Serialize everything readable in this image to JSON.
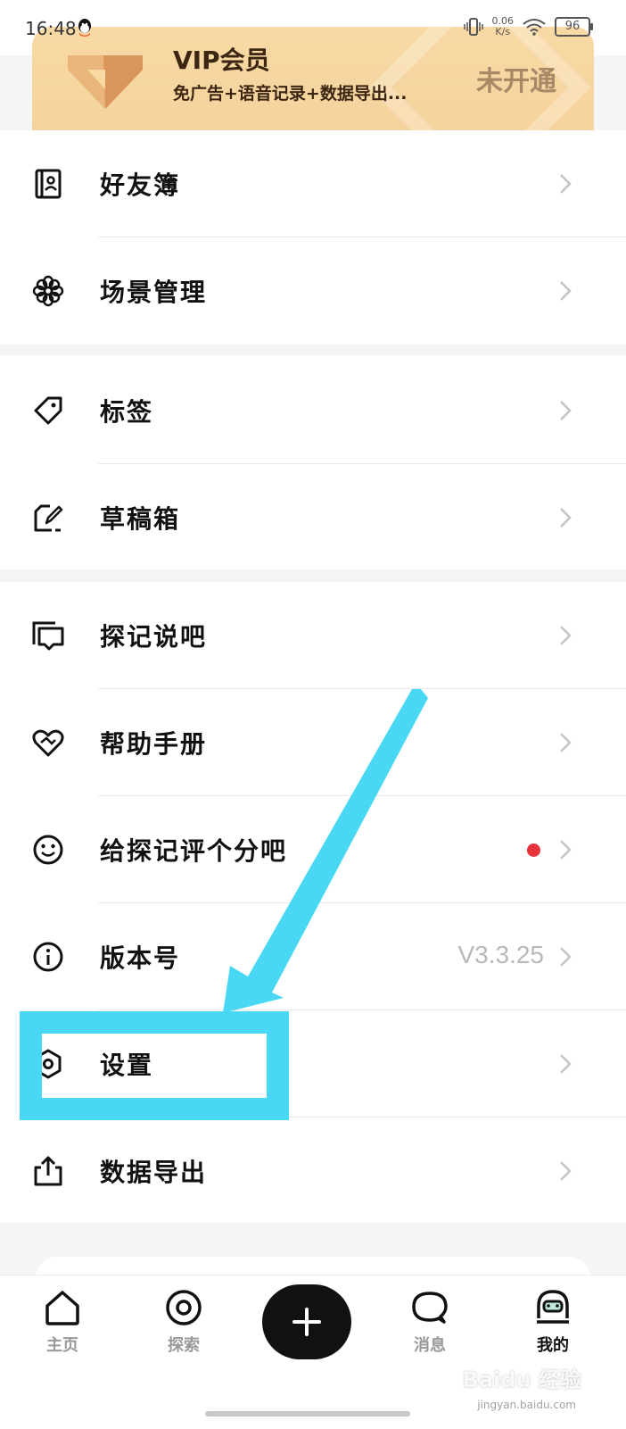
{
  "status_bar": {
    "time": "16:48",
    "net_speed_value": "0.06",
    "net_speed_unit": "K/s",
    "battery": "96"
  },
  "vip": {
    "title": "VIP会员",
    "subtitle": "免广告+语音记录+数据导出...",
    "status": "未开通"
  },
  "menu_groups": [
    [
      {
        "label": "好友簿",
        "icon": "contacts-book-icon"
      },
      {
        "label": "场景管理",
        "icon": "flower-icon"
      }
    ],
    [
      {
        "label": "标签",
        "icon": "tag-icon"
      },
      {
        "label": "草稿箱",
        "icon": "draft-edit-icon"
      }
    ],
    [
      {
        "label": "探记说吧",
        "icon": "chat-bubble-icon"
      },
      {
        "label": "帮助手册",
        "icon": "heart-handshake-icon"
      },
      {
        "label": "给探记评个分吧",
        "icon": "smiley-icon",
        "badge": "red-dot"
      },
      {
        "label": "版本号",
        "icon": "info-icon",
        "value": "V3.3.25"
      },
      {
        "label": "设置",
        "icon": "settings-hexagon-icon"
      },
      {
        "label": "数据导出",
        "icon": "share-upload-icon"
      }
    ]
  ],
  "tabbar": {
    "home": "主页",
    "explore": "探索",
    "messages": "消息",
    "me": "我的"
  },
  "watermark": {
    "brand": "Baidu 经验",
    "url": "jingyan.baidu.com"
  },
  "colors": {
    "vip_bg": "#f5d39d",
    "accent_annotation": "#49d8f4",
    "badge_red": "#e8323c",
    "add_button": "#111111"
  }
}
